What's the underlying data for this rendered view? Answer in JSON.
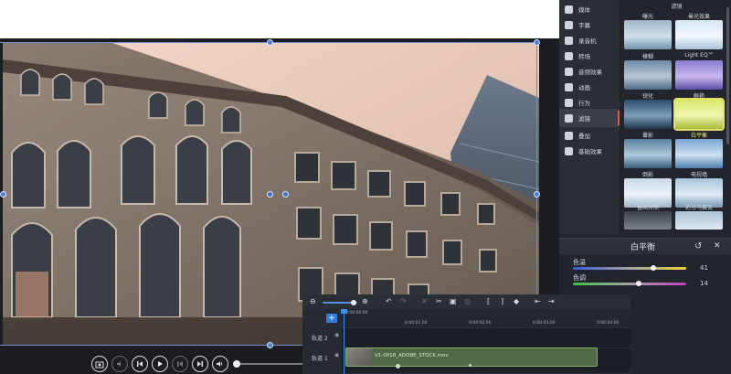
{
  "sidebar": {
    "nav_items": [
      {
        "label": "媒体",
        "icon": "media-icon"
      },
      {
        "label": "字幕",
        "icon": "text-icon"
      },
      {
        "label": "录音机",
        "icon": "microphone-icon"
      },
      {
        "label": "转场",
        "icon": "transitions-icon"
      },
      {
        "label": "音频效果",
        "icon": "audio-effects-icon"
      },
      {
        "label": "动画",
        "icon": "animation-icon"
      },
      {
        "label": "行为",
        "icon": "behavior-icon"
      },
      {
        "label": "滤镜",
        "icon": "filter-icon"
      },
      {
        "label": "叠加",
        "icon": "overlay-icon"
      },
      {
        "label": "基础效果",
        "icon": "basic-effects-icon"
      }
    ],
    "active_index": 7,
    "filters_header": "滤镜",
    "filters": [
      {
        "label": "曝光"
      },
      {
        "label": "晕光效果"
      },
      {
        "label": "模糊"
      },
      {
        "label": "Light EQ™"
      },
      {
        "label": "锐化"
      },
      {
        "label": "鲜艳"
      },
      {
        "label": "暈影"
      },
      {
        "label": "白平衡"
      },
      {
        "label": "倒影"
      },
      {
        "label": "电视墙"
      },
      {
        "label": "叠画对照"
      },
      {
        "label": "彩分马赛克"
      }
    ],
    "selected_filter_index": 7
  },
  "white_balance": {
    "title": "白平衡",
    "reset_icon": "reset-icon",
    "close_icon": "close-icon",
    "temperature_label": "色温",
    "temperature_value": "41",
    "tint_label": "色调",
    "tint_value": "14",
    "temperature_level": 0.71,
    "tint_level": 0.58
  },
  "timeline": {
    "toolbar_icons": [
      "zoom-out-icon",
      "zoom-in-icon",
      "undo-icon",
      "redo-icon",
      "delete-icon",
      "cut-icon",
      "copy-icon",
      "paste-icon",
      "mark-in-icon",
      "mark-out-icon",
      "marker-icon",
      "split-left-icon",
      "split-right-icon"
    ],
    "ruler_ticks": [
      "0:00:00.00",
      "0:00:01.00",
      "0:00:02.00",
      "0:00:03.00",
      "0:00:04.00"
    ],
    "tracks": [
      {
        "label": "轨道 2"
      },
      {
        "label": "轨道 1"
      }
    ],
    "clip_name": "V1-0018_ADOBE_STOCK.mov",
    "add_label": "+"
  },
  "playback": {
    "buttons": [
      "camera-icon",
      "volume-down-icon",
      "step-back-icon",
      "play-icon",
      "skip-start-icon",
      "skip-end-icon",
      "volume-icon"
    ]
  },
  "colors": {
    "accent": "#2f7de0",
    "selection": "#e6e06a",
    "clip": "#4f6a45",
    "active_marker": "#e05a4f"
  }
}
